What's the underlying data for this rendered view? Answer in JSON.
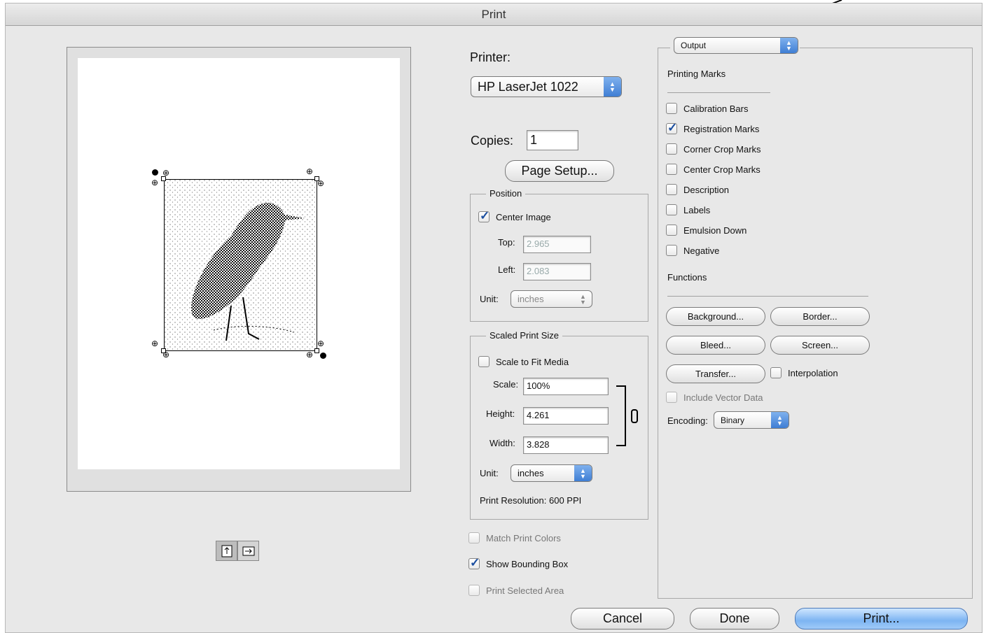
{
  "window": {
    "title": "Print"
  },
  "preview": {
    "orientation": [
      "portrait-icon",
      "landscape-icon"
    ]
  },
  "printer": {
    "label": "Printer:",
    "value": "HP LaserJet 1022"
  },
  "copies": {
    "label": "Copies:",
    "value": "1"
  },
  "page_setup_label": "Page Setup...",
  "position": {
    "title": "Position",
    "center_image": {
      "label": "Center Image",
      "checked": true
    },
    "top": {
      "label": "Top:",
      "value": "2.965"
    },
    "left": {
      "label": "Left:",
      "value": "2.083"
    },
    "unit": {
      "label": "Unit:",
      "value": "inches"
    }
  },
  "scaled": {
    "title": "Scaled Print Size",
    "scale_to_fit": {
      "label": "Scale to Fit Media",
      "checked": false
    },
    "scale": {
      "label": "Scale:",
      "value": "100%"
    },
    "height": {
      "label": "Height:",
      "value": "4.261"
    },
    "width": {
      "label": "Width:",
      "value": "3.828"
    },
    "unit": {
      "label": "Unit:",
      "value": "inches"
    },
    "resolution": "Print Resolution: 600 PPI"
  },
  "options": {
    "match_print_colors": "Match Print Colors",
    "show_bounding_box": "Show Bounding Box",
    "print_selected_area": "Print Selected Area"
  },
  "output": {
    "popup": "Output",
    "printing_marks_title": "Printing Marks",
    "marks": [
      {
        "label": "Calibration Bars",
        "checked": false
      },
      {
        "label": "Registration Marks",
        "checked": true
      },
      {
        "label": "Corner Crop Marks",
        "checked": false
      },
      {
        "label": "Center Crop Marks",
        "checked": false
      },
      {
        "label": "Description",
        "checked": false
      },
      {
        "label": "Labels",
        "checked": false
      },
      {
        "label": "Emulsion Down",
        "checked": false
      },
      {
        "label": "Negative",
        "checked": false
      }
    ],
    "functions_title": "Functions",
    "buttons": {
      "background": "Background...",
      "border": "Border...",
      "bleed": "Bleed...",
      "screen": "Screen...",
      "transfer": "Transfer..."
    },
    "interpolation": "Interpolation",
    "include_vector_data": "Include Vector Data",
    "encoding": {
      "label": "Encoding:",
      "value": "Binary"
    }
  },
  "footer": {
    "cancel": "Cancel",
    "done": "Done",
    "print": "Print..."
  }
}
